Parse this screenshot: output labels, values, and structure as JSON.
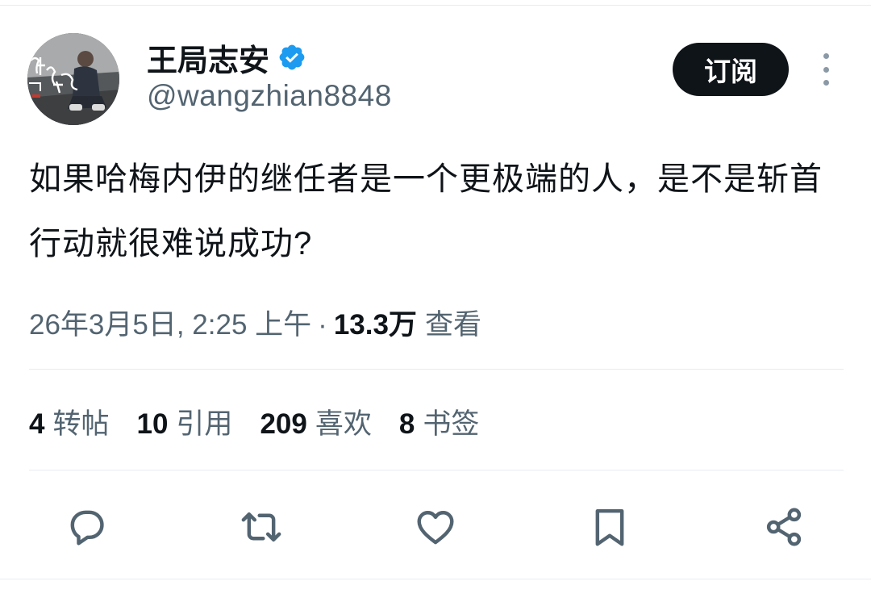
{
  "author": {
    "display_name": "王局志安",
    "handle": "@wangzhian8848",
    "verified_icon": "verified-badge-icon",
    "avatar": "avatar-photo"
  },
  "header": {
    "subscribe_label": "订阅",
    "more_icon": "more-vertical-icon"
  },
  "tweet": {
    "text": "如果哈梅内伊的继任者是一个更极端的人，是不是斩首行动就很难说成功?",
    "timestamp": "26年3月5日, 2:25 上午",
    "separator": "·",
    "views_count": "13.3万",
    "views_label": "查看"
  },
  "stats": [
    {
      "count": "4",
      "label": "转帖"
    },
    {
      "count": "10",
      "label": "引用"
    },
    {
      "count": "209",
      "label": "喜欢"
    },
    {
      "count": "8",
      "label": "书签"
    }
  ],
  "actions": [
    {
      "name": "reply",
      "icon": "reply-icon"
    },
    {
      "name": "retweet",
      "icon": "retweet-icon"
    },
    {
      "name": "like",
      "icon": "heart-icon"
    },
    {
      "name": "bookmark",
      "icon": "bookmark-icon"
    },
    {
      "name": "share",
      "icon": "share-icon"
    }
  ],
  "colors": {
    "text_primary": "#0f1419",
    "text_secondary": "#536471",
    "verified_blue": "#1d9bf0",
    "divider": "#e6ecf0"
  }
}
